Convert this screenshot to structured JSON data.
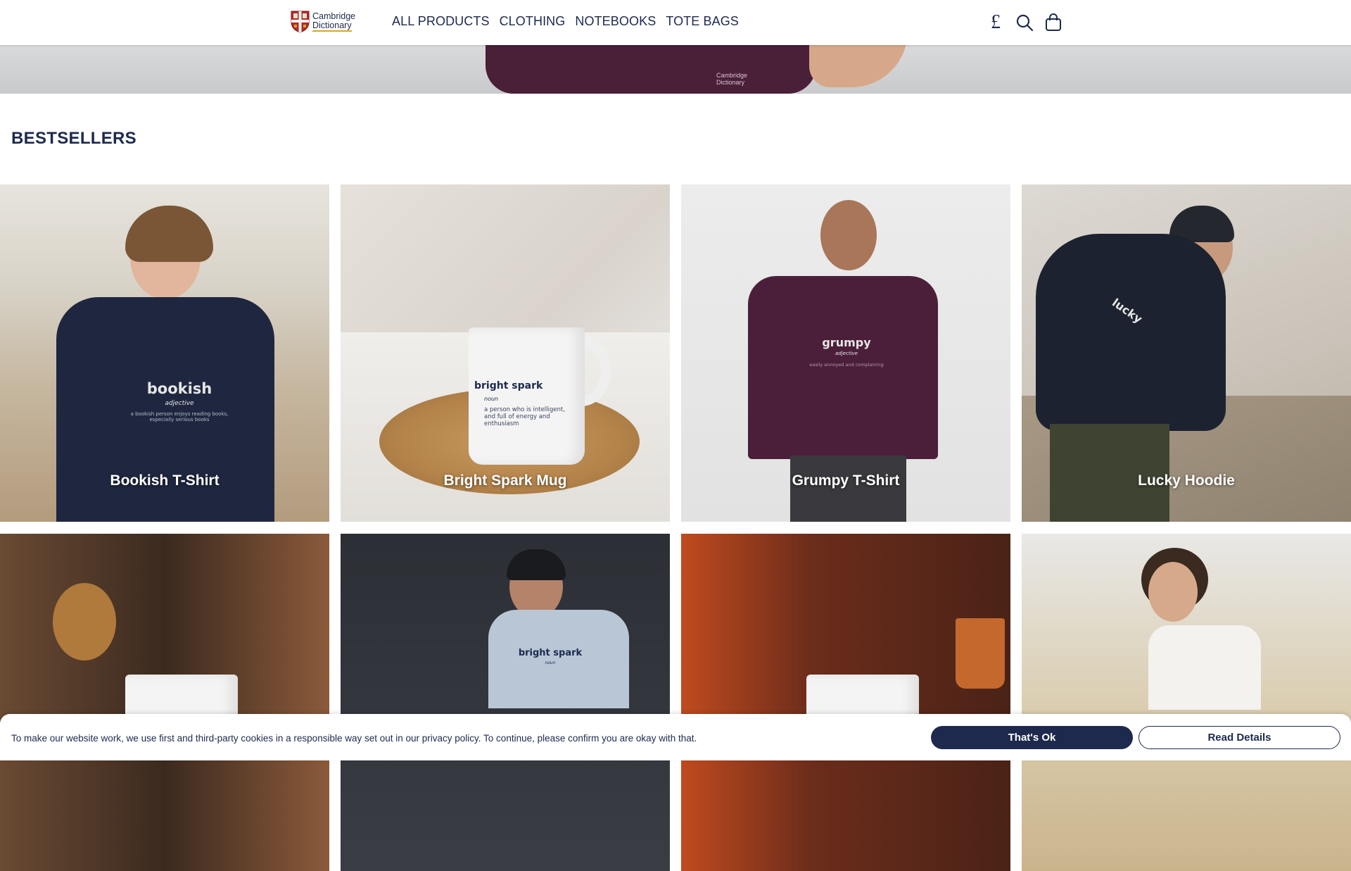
{
  "header": {
    "logo": {
      "line1": "Cambridge",
      "line2": "Dictionary"
    },
    "nav": [
      "ALL PRODUCTS",
      "CLOTHING",
      "NOTEBOOKS",
      "TOTE BAGS"
    ],
    "icons": {
      "currency": "£",
      "search": "search-icon",
      "cart": "shopping-bag-icon"
    }
  },
  "hero": {
    "mini_logo": "Cambridge Dictionary"
  },
  "bestsellers": {
    "title": "BESTSELLERS",
    "products": [
      {
        "name": "Bookish T-Shirt",
        "print_word": "bookish",
        "print_pos": "adjective",
        "print_def": "a bookish person enjoys reading books, especially serious books"
      },
      {
        "name": "Bright Spark Mug",
        "print_word": "bright spark",
        "print_pos": "noun",
        "print_def": "a person who is intelligent, and full of energy and enthusiasm"
      },
      {
        "name": "Grumpy T-Shirt",
        "print_word": "grumpy",
        "print_pos": "adjective",
        "print_def": "easily annoyed and complaining"
      },
      {
        "name": "Lucky Hoodie",
        "print_word": "lucky",
        "print_pos": "",
        "print_def": ""
      },
      {
        "name": "",
        "print_word": "",
        "print_pos": "",
        "print_def": ""
      },
      {
        "name": "",
        "print_word": "bright spark",
        "print_pos": "noun",
        "print_def": ""
      },
      {
        "name": "",
        "print_word": "",
        "print_pos": "",
        "print_def": ""
      },
      {
        "name": "",
        "print_word": "",
        "print_pos": "",
        "print_def": ""
      }
    ]
  },
  "cookie_banner": {
    "text": "To make our website work, we use first and third-party cookies in a responsible way set out in our privacy policy. To continue, please confirm you are okay with that.",
    "accept_label": "That's Ok",
    "details_label": "Read Details"
  },
  "colors": {
    "brand_navy": "#1d2a4d",
    "accent_gold": "#d0a72b"
  }
}
